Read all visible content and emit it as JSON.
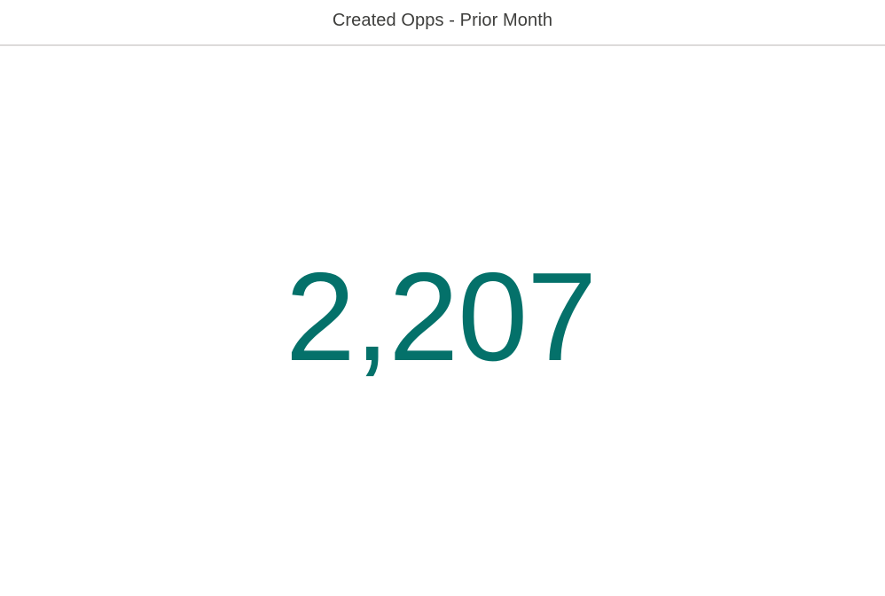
{
  "widget": {
    "title": "Created Opps - Prior Month",
    "metric_value": "2,207"
  },
  "colors": {
    "metric": "#04716a",
    "title": "#3e3e3c",
    "divider": "#dddbda",
    "background": "#ffffff"
  }
}
